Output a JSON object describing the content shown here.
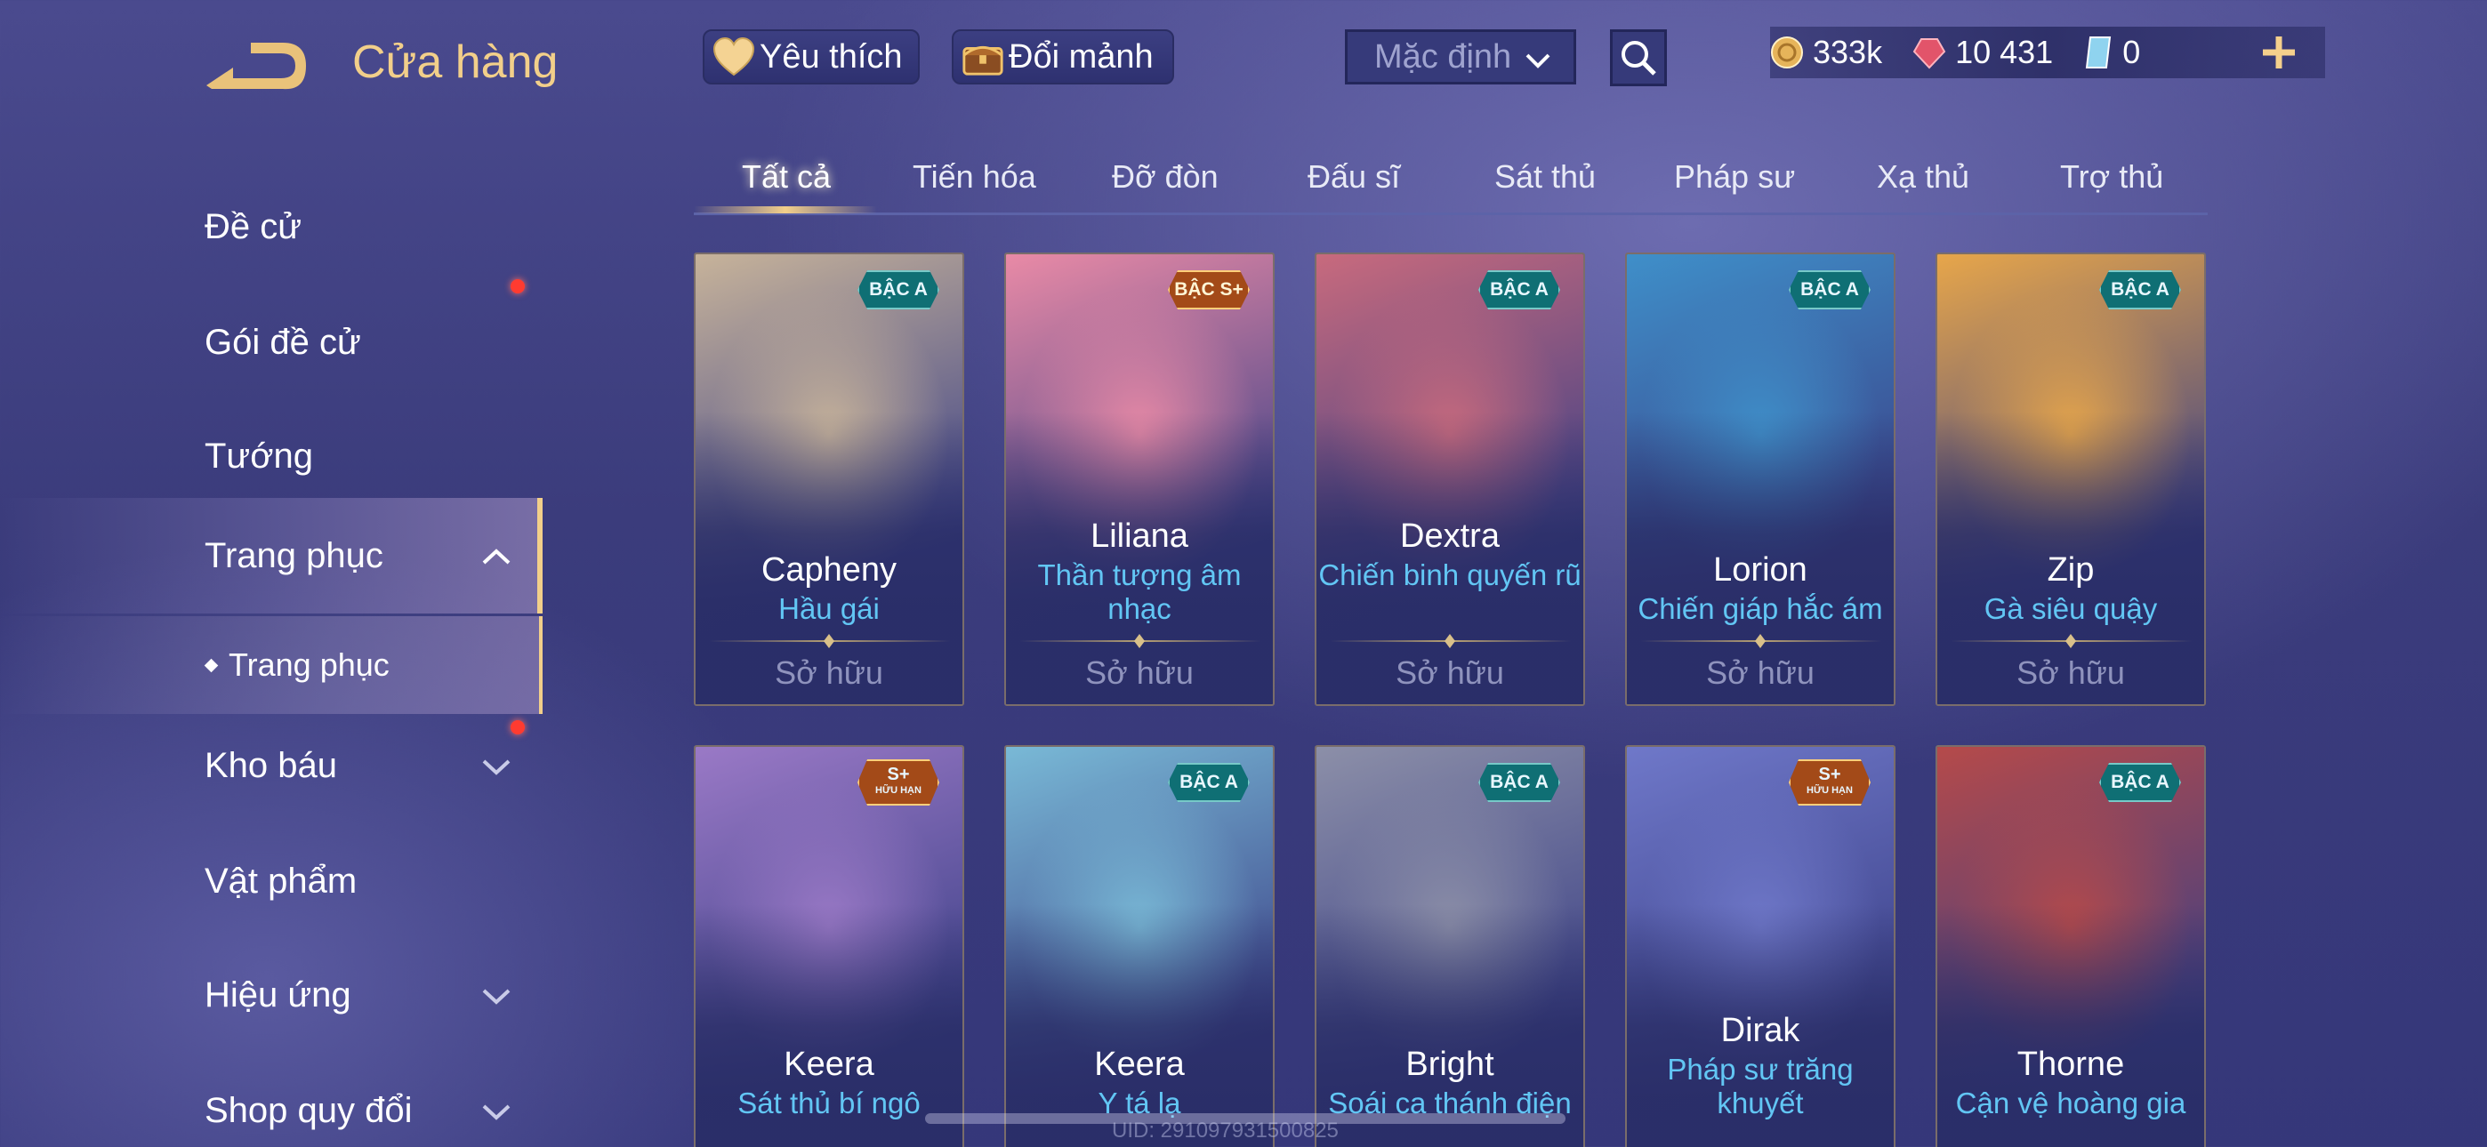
{
  "header": {
    "title": "Cửa hàng",
    "favorite_label": "Yêu thích",
    "shard_label": "Đổi mảnh",
    "sort_value": "Mặc định",
    "currency": {
      "gold": "333k",
      "vouchers": "10 431",
      "tickets": "0"
    }
  },
  "sidebar": {
    "items": [
      {
        "label": "Đề cử"
      },
      {
        "label": "Gói đề cử"
      },
      {
        "label": "Tướng"
      },
      {
        "label": "Trang phục"
      },
      {
        "label": "Trang phục"
      },
      {
        "label": "Kho báu"
      },
      {
        "label": "Vật phẩm"
      },
      {
        "label": "Hiệu ứng"
      },
      {
        "label": "Shop quy đổi"
      }
    ]
  },
  "tabs": [
    "Tất cả",
    "Tiến hóa",
    "Đỡ đòn",
    "Đấu sĩ",
    "Sát thủ",
    "Pháp sư",
    "Xạ thủ",
    "Trợ thủ"
  ],
  "cards": [
    {
      "hero": "Capheny",
      "skin": "Hầu gái",
      "badge": "BẬC A",
      "status": "Sở hữu",
      "accent": "#c7b39a"
    },
    {
      "hero": "Liliana",
      "skin": "Thần tượng âm nhạc",
      "badge": "BẬC S+",
      "status": "Sở hữu",
      "accent": "#e98aa6"
    },
    {
      "hero": "Dextra",
      "skin": "Chiến binh quyến rũ",
      "badge": "BẬC A",
      "status": "Sở hữu",
      "accent": "#c86a7d"
    },
    {
      "hero": "Lorion",
      "skin": "Chiến giáp hắc ám",
      "badge": "BẬC A",
      "status": "Sở hữu",
      "accent": "#3f8fc9"
    },
    {
      "hero": "Zip",
      "skin": "Gà siêu quậy",
      "badge": "BẬC A",
      "status": "Sở hữu",
      "accent": "#e7a64a"
    },
    {
      "hero": "Keera",
      "skin": "Sát thủ bí ngô",
      "badge": "S+",
      "badge_sub": "HỮU HẠN",
      "accent": "#9a79c6"
    },
    {
      "hero": "Keera",
      "skin": "Y tá lạ",
      "badge": "BẬC A",
      "accent": "#79b9d6"
    },
    {
      "hero": "Bright",
      "skin": "Soái ca thánh điện",
      "badge": "BẬC A",
      "accent": "#8c8fa8"
    },
    {
      "hero": "Dirak",
      "skin": "Pháp sư trăng khuyết",
      "badge": "S+",
      "badge_sub": "HỮU HẠN",
      "accent": "#6f78c9"
    },
    {
      "hero": "Thorne",
      "skin": "Cận vệ hoàng gia",
      "badge": "BẬC A",
      "accent": "#b54a4a"
    }
  ],
  "uid": "UID: 291097931500825"
}
